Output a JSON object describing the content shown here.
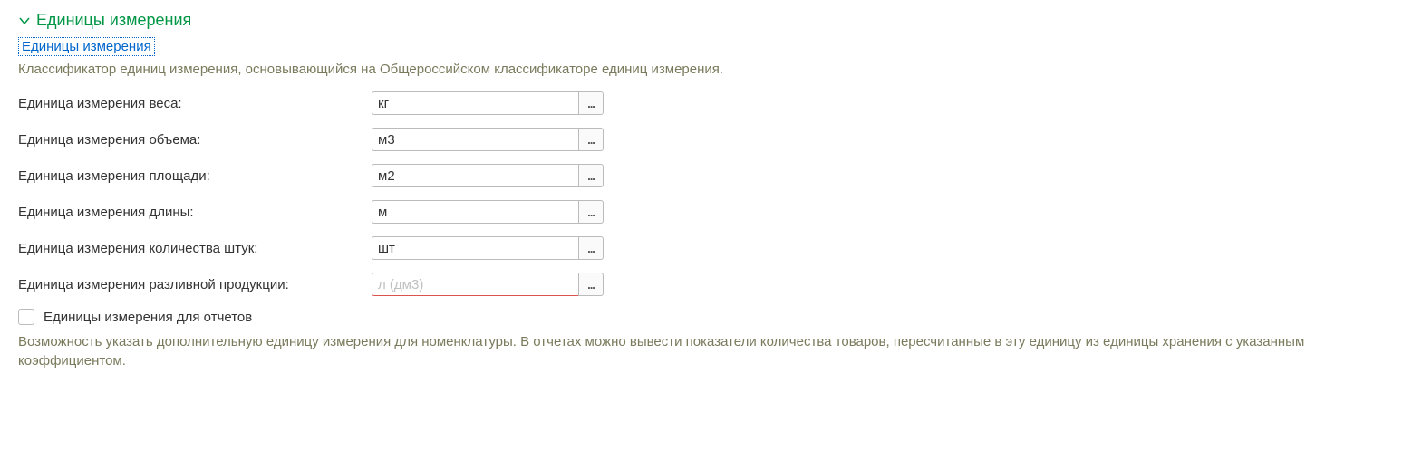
{
  "section": {
    "title": "Единицы измерения",
    "link": "Единицы измерения",
    "description": "Классификатор единиц измерения, основывающийся на Общероссийском классификаторе единиц измерения."
  },
  "fields": {
    "weight": {
      "label": "Единица измерения веса:",
      "value": "кг"
    },
    "volume": {
      "label": "Единица измерения объема:",
      "value": "м3"
    },
    "area": {
      "label": "Единица измерения площади:",
      "value": "м2"
    },
    "length": {
      "label": "Единица измерения длины:",
      "value": "м"
    },
    "count": {
      "label": "Единица измерения количества штук:",
      "value": "шт"
    },
    "bulk": {
      "label": "Единица измерения разливной продукции:",
      "value": "",
      "placeholder": "л (дм3)"
    }
  },
  "checkbox": {
    "reports": {
      "label": "Единицы измерения для отчетов"
    }
  },
  "note": "Возможность указать дополнительную единицу измерения для номенклатуры. В отчетах можно вывести показатели количества товаров, пересчитанные в эту единицу из единицы хранения с указанным коэффициентом.",
  "picker": {
    "label": "..."
  }
}
